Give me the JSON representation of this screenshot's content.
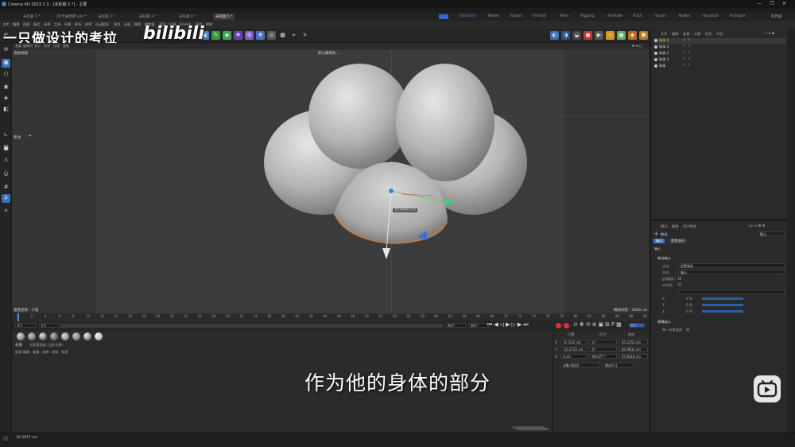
{
  "window": {
    "title": "Cinema 4D 2023.1.3 - [未标题 5 *] - 主要",
    "controls": [
      "—",
      "❐",
      "✕"
    ]
  },
  "tabs": [
    {
      "label": "未标题 1 *",
      "active": false
    },
    {
      "label": "2D卡通场景 x4d *",
      "active": false
    },
    {
      "label": "未标题 2 *",
      "active": false
    },
    {
      "label": "未标题 3 *",
      "active": false
    },
    {
      "label": "未标题 4 *",
      "active": false
    },
    {
      "label": "未标题 5 *",
      "active": true
    }
  ],
  "layouts": [
    "Standard",
    "Model",
    "Sculpt",
    "UV Edit",
    "Paint",
    "Rigging",
    "Animate",
    "Track",
    "Script",
    "Nodes",
    "Visualize",
    "Analyzer"
  ],
  "new_layout_label": "新界面",
  "menu": [
    "文件",
    "编辑",
    "创建",
    "模式",
    "选择",
    "工具",
    "网格",
    "样条",
    "体积",
    "运动图形",
    "角色",
    "动画",
    "模拟",
    "跟踪器",
    "渲染",
    "扩展",
    "Arnold",
    "窗口",
    "帮助"
  ],
  "watermark": {
    "channel": "一只做设计的考拉",
    "logo": "bilibili"
  },
  "viewport": {
    "menu": [
      "查看",
      "摄像机",
      "显示",
      "选项",
      "过滤",
      "面板"
    ],
    "name": "透视视图",
    "camera": "默认摄像机 ∴",
    "label_move": "移动",
    "distance_readout": "18.9946 cm",
    "grid_spacing": "网格间距 : 5000 cm",
    "hud_bottom_left": "查看变换 : 工程"
  },
  "timeline": {
    "ticks": [
      "0",
      "2",
      "4",
      "6",
      "8",
      "10",
      "12",
      "14",
      "16",
      "18",
      "20",
      "22",
      "24",
      "26",
      "28",
      "30",
      "32",
      "34",
      "36",
      "38",
      "40",
      "42",
      "44",
      "46",
      "48",
      "50",
      "52",
      "54",
      "56",
      "58",
      "60",
      "62",
      "64",
      "66",
      "68",
      "70",
      "72",
      "74",
      "76",
      "78",
      "80",
      "82",
      "84",
      "86",
      "88",
      "90"
    ],
    "start": "0 F",
    "current": "0 F",
    "end": "90 F",
    "end2": "90 F",
    "right_frame": "0 F"
  },
  "materials": {
    "menu_title": "材质",
    "toolbar": [
      "创建",
      "编辑",
      "查看",
      "选择",
      "材质",
      "纹理"
    ],
    "breadcrumb": "材质管理器   (当前合集)"
  },
  "coords": {
    "headers": [
      "位置",
      "尺寸",
      "旋转"
    ],
    "mode1": "对象 (相对)",
    "mode2": "绝对尺寸",
    "rows": [
      {
        "axis": "X",
        "pos": "-0.7232 cm",
        "size": "0 °",
        "rot": "65.2253 cm"
      },
      {
        "axis": "Y",
        "pos": "-55.2735 cm",
        "size": "0 °",
        "rot": "83.9834 cm"
      },
      {
        "axis": "Z",
        "pos": "0 cm",
        "size": "90.077 °",
        "rot": "47.8516 cm"
      }
    ]
  },
  "object_manager": {
    "menu": [
      "文件",
      "编辑",
      "查看",
      "对象",
      "标签",
      "书签"
    ],
    "objects": [
      "球体.4",
      "球体.3",
      "球体.2",
      "球体.1",
      "球体"
    ]
  },
  "attribute_manager": {
    "menu": [
      "模式",
      "编辑",
      "用户数据"
    ],
    "object_label": "移动",
    "tabs": [
      "轴心",
      "重置选择"
    ],
    "section": "轴心",
    "subsection": "移动轴心",
    "fields": [
      {
        "label": "方向",
        "value": "世界坐标"
      },
      {
        "label": "方向",
        "value": "轴心"
      },
      {
        "label": "启用轴心",
        "value": ""
      },
      {
        "label": "对齐到",
        "value": ""
      }
    ],
    "xyz": [
      {
        "label": "X",
        "value": "0 %"
      },
      {
        "label": "Y",
        "value": "0 %"
      },
      {
        "label": "Z",
        "value": "0 %"
      }
    ],
    "modeling_axis": "建模轴心",
    "single_object": "单一对象变换",
    "preset": "默认"
  },
  "status": {
    "text": "16.3017 cm"
  },
  "subtitle": "作为他的身体的部分"
}
